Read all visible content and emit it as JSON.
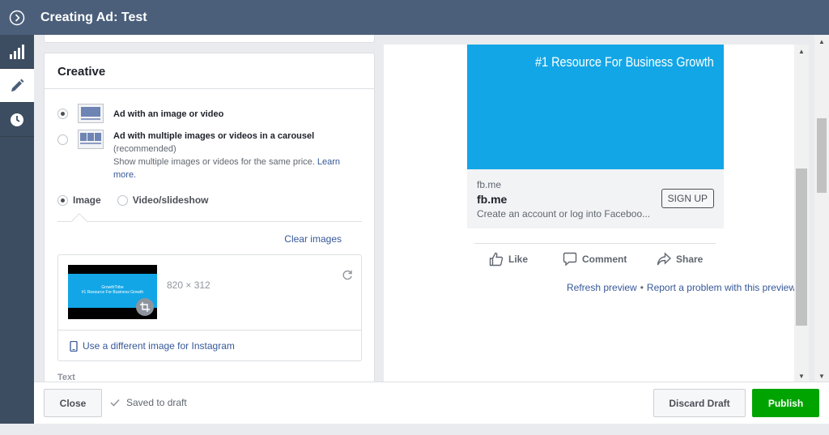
{
  "header": {
    "title": "Creating Ad: Test"
  },
  "nav": {
    "items": [
      "stats",
      "edit",
      "history"
    ]
  },
  "creative": {
    "heading": "Creative",
    "single": {
      "label": "Ad with an image or video"
    },
    "carousel": {
      "label": "Ad with multiple images or videos in a carousel",
      "recommended": "(recommended)",
      "description": "Show multiple images or videos for the same price.",
      "learn_more": "Learn more."
    },
    "format": {
      "image": "Image",
      "video": "Video/slideshow"
    },
    "clear_images": "Clear images",
    "image": {
      "dims": "820 × 312",
      "instagram": "Use a different image for Instagram",
      "thumb_text": "GrowthTribe\n#1 Resource For Business Growth",
      "thumb_title": "GrowthTribe",
      "thumb_tag": "#1 Resource For Business Growth"
    },
    "text_label": "Text"
  },
  "ad_preview": {
    "tagline": "#1 Resource For Business Growth",
    "domain": "fb.me",
    "headline": "fb.me",
    "description": "Create an account or log into Faceboo...",
    "cta": "SIGN UP",
    "actions": {
      "like": "Like",
      "comment": "Comment",
      "share": "Share"
    },
    "refresh": "Refresh preview",
    "separator": "•",
    "report": "Report a problem with this preview"
  },
  "footer": {
    "close": "Close",
    "saved": "Saved to draft",
    "discard": "Discard Draft",
    "publish": "Publish"
  },
  "colors": {
    "topbar": "#4b5f7a",
    "leftnav": "#3d4d61",
    "publish": "#00a400",
    "link": "#365899",
    "hero": "#12a6e6"
  }
}
